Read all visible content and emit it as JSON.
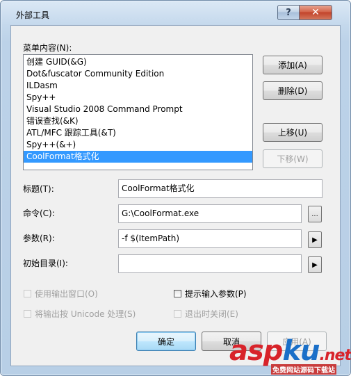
{
  "window": {
    "title": "外部工具",
    "help_glyph": "?",
    "close_glyph": "✕"
  },
  "menu_contents_label": "菜单内容(N):",
  "menu_items": [
    "创建 GUID(&G)",
    "Dot&fuscator Community Edition",
    "ILDasm",
    "Spy++",
    "Visual Studio 2008 Command Prompt",
    "错误查找(&K)",
    "ATL/MFC 跟踪工具(&T)",
    "Spy++(&+)",
    "CoolFormat格式化"
  ],
  "selected_index": 8,
  "buttons": {
    "add": "添加(A)",
    "delete": "删除(D)",
    "move_up": "上移(U)",
    "move_down": "下移(W)",
    "ok": "确定",
    "cancel": "取消",
    "apply": "应用(A)"
  },
  "fields": {
    "title_label": "标题(T):",
    "title_value": "CoolFormat格式化",
    "command_label": "命令(C):",
    "command_value": "G:\\CoolFormat.exe",
    "command_browse": "...",
    "args_label": "参数(R):",
    "args_value": "-f $(ItemPath)",
    "args_arrow": "▶",
    "initdir_label": "初始目录(I):",
    "initdir_value": "",
    "initdir_arrow": "▶"
  },
  "checkboxes": {
    "use_output_window": "使用输出窗口(O)",
    "prompt_for_args": "提示输入参数(P)",
    "treat_as_unicode": "将输出按 Unicode 处理(S)",
    "close_on_exit": "退出时关闭(E)"
  },
  "watermark": {
    "asp": "asp",
    "ku": "ku",
    "net": ".net",
    "sub": "免费网站源码下载站"
  }
}
